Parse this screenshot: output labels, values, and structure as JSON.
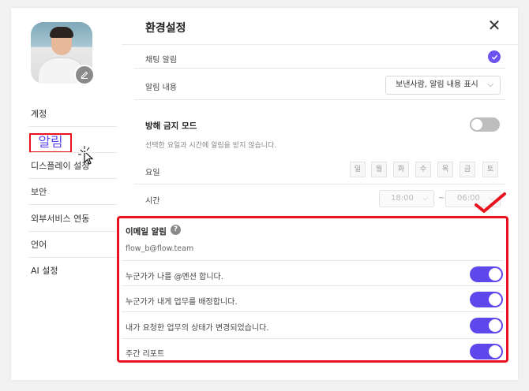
{
  "header": {
    "title": "환경설정"
  },
  "sidebar": {
    "items": [
      {
        "label": "계정"
      },
      {
        "label": "알림",
        "active": true
      },
      {
        "label": "디스플레이 설정"
      },
      {
        "label": "보안"
      },
      {
        "label": "외부서비스 연동"
      },
      {
        "label": "언어"
      },
      {
        "label": "AI 설정"
      }
    ]
  },
  "chat_alert": {
    "label": "채팅 알림",
    "checked": true
  },
  "alert_content": {
    "label": "알림 내용",
    "value": "보낸사람, 알림 내용 표시"
  },
  "dnd": {
    "title": "방해 금지 모드",
    "enabled": false,
    "description": "선택한 요일과 시간에 알림을 받지 않습니다.",
    "days_label": "요일",
    "days": [
      "일",
      "월",
      "화",
      "수",
      "목",
      "금",
      "토"
    ],
    "time_label": "시간",
    "start_time": "18:00",
    "end_time": "06:00",
    "separator": "~"
  },
  "email": {
    "title": "이메일 알림",
    "help": "?",
    "address": "flow_b@flow.team",
    "options": [
      {
        "label": "누군가가 나를 @멘션 합니다.",
        "enabled": true
      },
      {
        "label": "누군가가 내게 업무를 배정합니다.",
        "enabled": true
      },
      {
        "label": "내가 요청한 업무의 상태가 변경되었습니다.",
        "enabled": true
      },
      {
        "label": "주간 리포트",
        "enabled": true
      }
    ]
  },
  "colors": {
    "accent": "#5e48ec",
    "highlight": "#e8131f",
    "toggle_off": "#bdbdbd"
  },
  "icons": {
    "close": "close-icon",
    "edit": "pencil-icon",
    "check": "check-icon",
    "chevron": "chevron-down-icon",
    "help": "help-icon"
  }
}
